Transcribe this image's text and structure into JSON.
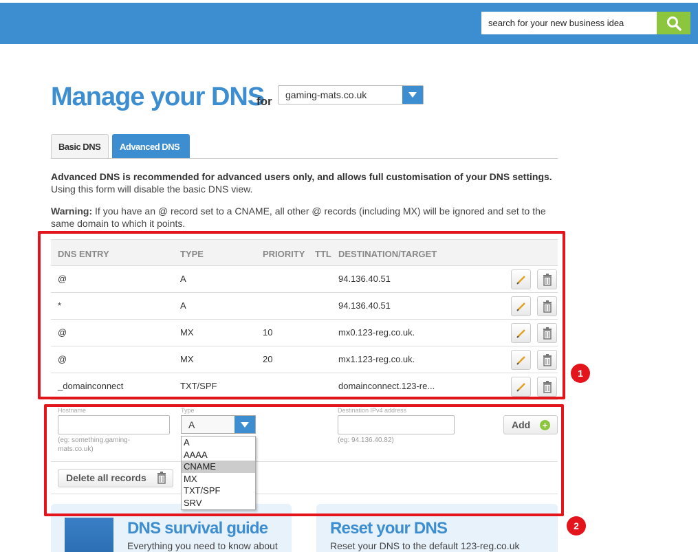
{
  "header": {
    "search_placeholder": "search for your new business idea",
    "search_icon": "search-icon"
  },
  "page": {
    "title": "Manage your DNS",
    "for_label": "for",
    "domain": "gaming-mats.co.uk"
  },
  "tabs": [
    {
      "label": "Basic DNS",
      "active": false
    },
    {
      "label": "Advanced DNS",
      "active": true
    }
  ],
  "intro": {
    "bold": "Advanced DNS is recommended for advanced users only, and allows full customisation of your DNS settings.",
    "text": "Using this form will disable the basic DNS view."
  },
  "warning": {
    "bold": "Warning:",
    "text": "If you have an @ record set to a CNAME, all other @ records (including MX) will be ignored and set to the same domain to which it points."
  },
  "table": {
    "headers": [
      "DNS ENTRY",
      "TYPE",
      "PRIORITY",
      "TTL",
      "DESTINATION/TARGET"
    ],
    "rows": [
      {
        "entry": "@",
        "type": "A",
        "priority": "",
        "ttl": "",
        "target": "94.136.40.51"
      },
      {
        "entry": "*",
        "type": "A",
        "priority": "",
        "ttl": "",
        "target": "94.136.40.51"
      },
      {
        "entry": "@",
        "type": "MX",
        "priority": "10",
        "ttl": "",
        "target": "mx0.123-reg.co.uk."
      },
      {
        "entry": "@",
        "type": "MX",
        "priority": "20",
        "ttl": "",
        "target": "mx1.123-reg.co.uk."
      },
      {
        "entry": "_domainconnect",
        "type": "TXT/SPF",
        "priority": "",
        "ttl": "",
        "target": "domainconnect.123-re..."
      }
    ]
  },
  "add_form": {
    "hostname_label": "Hostname",
    "hostname_hint": "(eg: something.gaming-mats.co.uk)",
    "type_label": "Type",
    "type_value": "A",
    "type_options": [
      "A",
      "AAAA",
      "CNAME",
      "MX",
      "TXT/SPF",
      "SRV"
    ],
    "highlighted_option": "CNAME",
    "destination_label": "Destination IPv4 address",
    "destination_hint": "(eg: 94.136.40.82)",
    "add_label": "Add",
    "delete_all_label": "Delete all records"
  },
  "annotations": {
    "badge1": "1",
    "badge2": "2",
    "color": "#e3141b"
  },
  "cards": [
    {
      "title": "DNS survival guide",
      "sub": "Everything you need to know about"
    },
    {
      "title": "Reset your DNS",
      "sub": "Reset your DNS to the default 123-reg.co.uk"
    }
  ],
  "colors": {
    "brand_blue": "#3d8ed0",
    "accent_green": "#8cc63e",
    "highlight_red": "#e3141b"
  }
}
